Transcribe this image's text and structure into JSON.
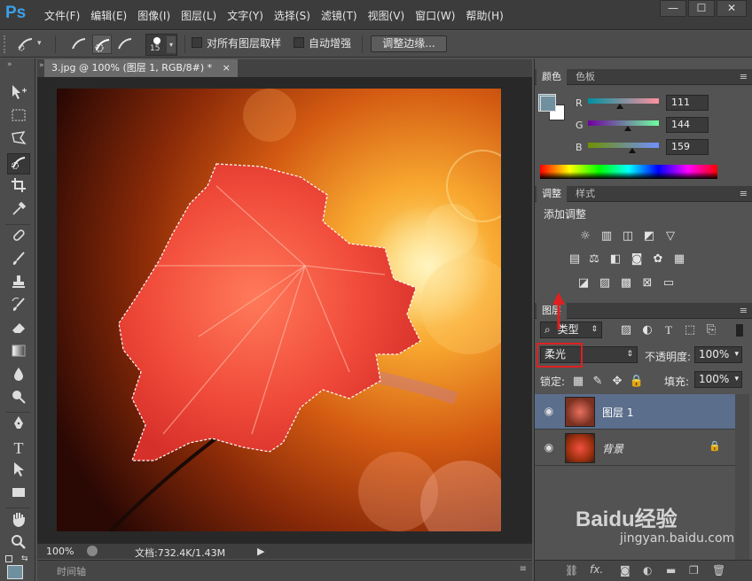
{
  "app": {
    "logo": "Ps"
  },
  "menu": [
    "文件(F)",
    "编辑(E)",
    "图像(I)",
    "图层(L)",
    "文字(Y)",
    "选择(S)",
    "滤镜(T)",
    "视图(V)",
    "窗口(W)",
    "帮助(H)"
  ],
  "window_controls": {
    "minimize": "—",
    "maximize": "☐",
    "close": "✕"
  },
  "options": {
    "brush_size": "15",
    "sample_all_layers": "对所有图层取样",
    "auto_enhance": "自动增强",
    "refine_edge": "调整边缘..."
  },
  "document": {
    "tab_title": "3.jpg @ 100% (图层 1, RGB/8#) *",
    "tab_close": "×",
    "zoom": "100%",
    "doc_info": "文档:732.4K/1.43M",
    "timeline": "时间轴"
  },
  "color_panel": {
    "tab_active": "颜色",
    "tab_other": "色板",
    "r_label": "R",
    "r_value": "111",
    "g_label": "G",
    "g_value": "144",
    "b_label": "B",
    "b_value": "159",
    "foreground_color": "#6f909f"
  },
  "adjust_panel": {
    "tab_active": "调整",
    "tab_other": "样式",
    "title": "添加调整"
  },
  "layers_panel": {
    "tab_active": "图层",
    "filter_kind": "类型",
    "blend_mode": "柔光",
    "opacity_label": "不透明度:",
    "opacity_value": "100%",
    "lock_label": "锁定:",
    "fill_label": "填充:",
    "fill_value": "100%",
    "layers": [
      {
        "name": "图层 1",
        "selected": true
      },
      {
        "name": "背景",
        "selected": false
      }
    ],
    "fx_label": "fx."
  },
  "watermark": {
    "brand": "Baidu经验",
    "url": "jingyan.baidu.com"
  }
}
